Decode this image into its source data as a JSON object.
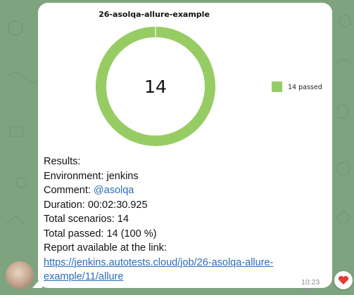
{
  "colors": {
    "background": "#7ea47f",
    "bubble": "#ffffff",
    "passed": "#97cc64",
    "link": "#2b6cb8"
  },
  "chart_data": {
    "type": "pie",
    "title": "26-asolqa-allure-example",
    "center_label": "14",
    "categories": [
      "passed"
    ],
    "values": [
      14
    ],
    "legend": [
      "14 passed"
    ],
    "legend_position": "right",
    "donut": true
  },
  "message": {
    "results_label": "Results:",
    "environment_label": "Environment:",
    "environment_value": "jenkins",
    "comment_label": "Comment:",
    "comment_value": "@asolqa",
    "duration_label": "Duration:",
    "duration_value": "00:02:30.925",
    "total_scenarios_label": "Total scenarios:",
    "total_scenarios_value": "14",
    "total_passed_label": "Total passed:",
    "total_passed_value": "14 (100 %)",
    "report_label": "Report available at the link:",
    "report_link_line1": "https://jenkins.autotests.cloud/job/26-asolqa-allure-",
    "report_link_line2": "example/11/allure"
  },
  "meta": {
    "time": "10:23 PM",
    "reaction": "heart-icon"
  }
}
